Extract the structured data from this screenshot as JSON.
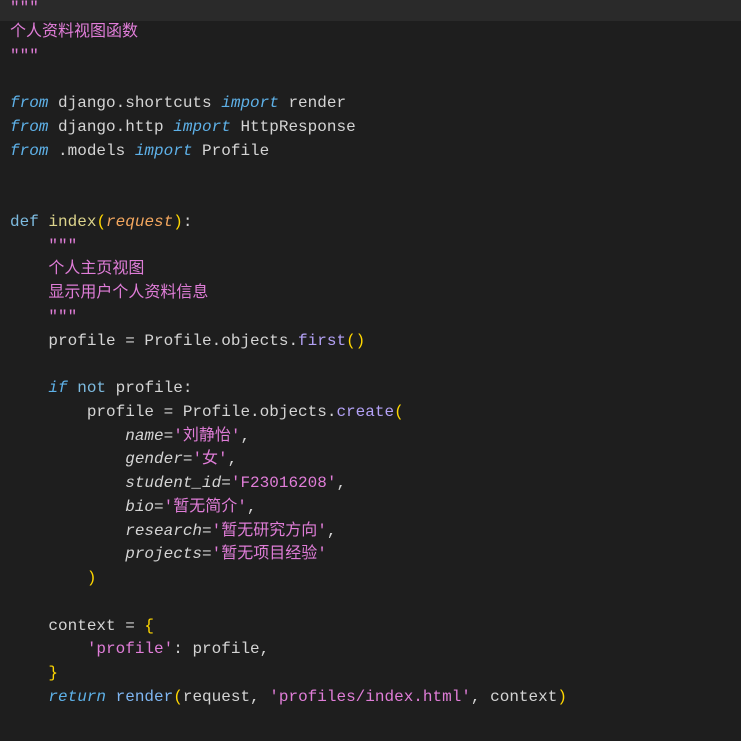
{
  "editor": {
    "theme": {
      "background": "#1e1e1e",
      "current_line": "#2a2a2a",
      "foreground": "#d4d4d4"
    },
    "lines": [
      {
        "tokens": [
          {
            "text": "\"\"\"",
            "color": "#e07dd8"
          }
        ]
      },
      {
        "tokens": [
          {
            "text": "个人资料视图函数",
            "color": "#e07dd8"
          }
        ]
      },
      {
        "tokens": [
          {
            "text": "\"\"\"",
            "color": "#e07dd8"
          }
        ]
      },
      {
        "tokens": []
      },
      {
        "tokens": [
          {
            "text": "from",
            "color": "#5eb1e8",
            "italic": true
          },
          {
            "text": " django.shortcuts "
          },
          {
            "text": "import",
            "color": "#5eb1e8",
            "italic": true
          },
          {
            "text": " render"
          }
        ]
      },
      {
        "tokens": [
          {
            "text": "from",
            "color": "#5eb1e8",
            "italic": true
          },
          {
            "text": " django.http "
          },
          {
            "text": "import",
            "color": "#5eb1e8",
            "italic": true
          },
          {
            "text": " HttpResponse"
          }
        ]
      },
      {
        "tokens": [
          {
            "text": "from",
            "color": "#5eb1e8",
            "italic": true
          },
          {
            "text": " .models "
          },
          {
            "text": "import",
            "color": "#5eb1e8",
            "italic": true
          },
          {
            "text": " Profile"
          }
        ]
      },
      {
        "tokens": []
      },
      {
        "tokens": []
      },
      {
        "tokens": [
          {
            "text": "def",
            "color": "#7dbbe0"
          },
          {
            "text": " "
          },
          {
            "text": "index",
            "color": "#dcd48c"
          },
          {
            "text": "(",
            "color": "#ffd700"
          },
          {
            "text": "request",
            "color": "#f2a65e",
            "italic": true
          },
          {
            "text": ")",
            "color": "#ffd700"
          },
          {
            "text": ":"
          }
        ]
      },
      {
        "tokens": [
          {
            "text": "    "
          },
          {
            "text": "\"\"\"",
            "color": "#e07dd8"
          }
        ]
      },
      {
        "tokens": [
          {
            "text": "    "
          },
          {
            "text": "个人主页视图",
            "color": "#e07dd8"
          }
        ]
      },
      {
        "tokens": [
          {
            "text": "    "
          },
          {
            "text": "显示用户个人资料信息",
            "color": "#e07dd8"
          }
        ]
      },
      {
        "tokens": [
          {
            "text": "    "
          },
          {
            "text": "\"\"\"",
            "color": "#e07dd8"
          }
        ]
      },
      {
        "tokens": [
          {
            "text": "    profile = Profile.objects."
          },
          {
            "text": "first",
            "color": "#b3a1f5"
          },
          {
            "text": "()",
            "color": "#ffd700"
          }
        ]
      },
      {
        "tokens": []
      },
      {
        "tokens": [
          {
            "text": "    "
          },
          {
            "text": "if",
            "color": "#5eb1e8",
            "italic": true
          },
          {
            "text": " "
          },
          {
            "text": "not",
            "color": "#7dbbe0"
          },
          {
            "text": " profile:"
          }
        ]
      },
      {
        "tokens": [
          {
            "text": "        profile = Profile.objects."
          },
          {
            "text": "create",
            "color": "#b3a1f5"
          },
          {
            "text": "(",
            "color": "#ffd700"
          }
        ]
      },
      {
        "tokens": [
          {
            "text": "            "
          },
          {
            "text": "name",
            "italic": true
          },
          {
            "text": "="
          },
          {
            "text": "'刘静怡'",
            "color": "#e07dd8"
          },
          {
            "text": ","
          }
        ]
      },
      {
        "tokens": [
          {
            "text": "            "
          },
          {
            "text": "gender",
            "italic": true
          },
          {
            "text": "="
          },
          {
            "text": "'女'",
            "color": "#e07dd8"
          },
          {
            "text": ","
          }
        ]
      },
      {
        "tokens": [
          {
            "text": "            "
          },
          {
            "text": "student_id",
            "italic": true
          },
          {
            "text": "="
          },
          {
            "text": "'F23016208'",
            "color": "#e07dd8"
          },
          {
            "text": ","
          }
        ]
      },
      {
        "tokens": [
          {
            "text": "            "
          },
          {
            "text": "bio",
            "italic": true
          },
          {
            "text": "="
          },
          {
            "text": "'暂无简介'",
            "color": "#e07dd8"
          },
          {
            "text": ","
          }
        ]
      },
      {
        "tokens": [
          {
            "text": "            "
          },
          {
            "text": "research",
            "italic": true
          },
          {
            "text": "="
          },
          {
            "text": "'暂无研究方向'",
            "color": "#e07dd8"
          },
          {
            "text": ","
          }
        ]
      },
      {
        "tokens": [
          {
            "text": "            "
          },
          {
            "text": "projects",
            "italic": true
          },
          {
            "text": "="
          },
          {
            "text": "'暂无项目经验'",
            "color": "#e07dd8"
          }
        ]
      },
      {
        "tokens": [
          {
            "text": "        "
          },
          {
            "text": ")",
            "color": "#ffd700"
          }
        ]
      },
      {
        "tokens": []
      },
      {
        "tokens": [
          {
            "text": "    context = "
          },
          {
            "text": "{",
            "color": "#ffd700"
          }
        ]
      },
      {
        "tokens": [
          {
            "text": "        "
          },
          {
            "text": "'profile'",
            "color": "#e07dd8"
          },
          {
            "text": ": profile,"
          }
        ]
      },
      {
        "tokens": [
          {
            "text": "    "
          },
          {
            "text": "}",
            "color": "#ffd700"
          }
        ]
      },
      {
        "tokens": [
          {
            "text": "    "
          },
          {
            "text": "return",
            "color": "#5eb1e8",
            "italic": true
          },
          {
            "text": " "
          },
          {
            "text": "render",
            "color": "#7fb6f2"
          },
          {
            "text": "(",
            "color": "#ffd700"
          },
          {
            "text": "request, "
          },
          {
            "text": "'profiles/index.html'",
            "color": "#e07dd8"
          },
          {
            "text": ", context"
          },
          {
            "text": ")",
            "color": "#ffd700"
          }
        ]
      }
    ]
  }
}
